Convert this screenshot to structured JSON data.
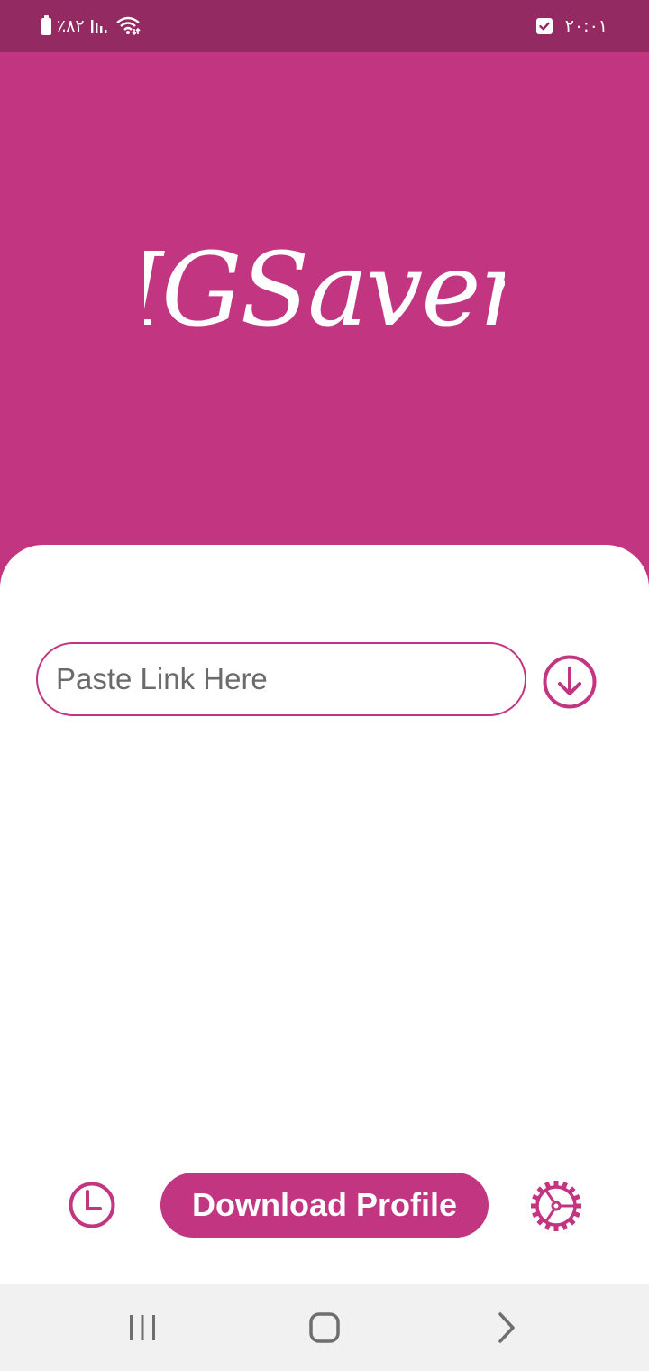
{
  "status_bar": {
    "battery_percent": "٪۸۲",
    "time": "۲۰:۰۱",
    "left_icons": [
      "battery-icon",
      "signal-icon",
      "wifi-icon"
    ],
    "right_icons": [
      "checkbox-notification-icon"
    ]
  },
  "header": {
    "logo_text": "IGSaver"
  },
  "main": {
    "link_input": {
      "placeholder": "Paste Link Here",
      "value": ""
    },
    "download_button_icon": "download-arrow-icon"
  },
  "bottom_bar": {
    "history_icon": "clock-icon",
    "download_profile_label": "Download Profile",
    "settings_icon": "gear-icon"
  },
  "nav_bar": {
    "icons": [
      "recent-apps-icon",
      "home-icon",
      "back-icon"
    ]
  },
  "colors": {
    "brand": "#c13581",
    "status_bar": "#932a61",
    "nav_bar": "#f1f1f1",
    "card": "#ffffff"
  }
}
